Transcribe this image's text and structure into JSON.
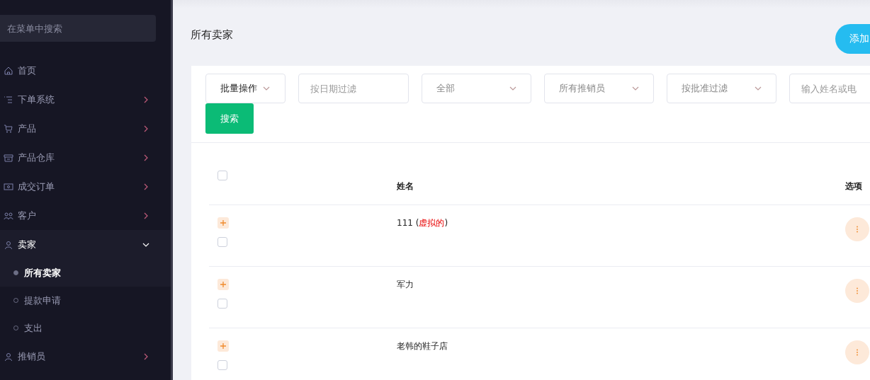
{
  "sidebar": {
    "search": {
      "placeholder": "在菜单中搜索"
    },
    "items": [
      {
        "label": "首页",
        "expandable": false,
        "expanded": false
      },
      {
        "label": "下单系统",
        "expandable": true,
        "expanded": false
      },
      {
        "label": "产品",
        "expandable": true,
        "expanded": false
      },
      {
        "label": "产品仓库",
        "expandable": true,
        "expanded": false
      },
      {
        "label": "成交订单",
        "expandable": true,
        "expanded": false
      },
      {
        "label": "客户",
        "expandable": true,
        "expanded": false
      },
      {
        "label": "卖家",
        "expandable": true,
        "expanded": true,
        "children": [
          {
            "label": "所有卖家",
            "selected": true
          },
          {
            "label": "提款申请",
            "selected": false
          },
          {
            "label": "支出",
            "selected": false
          }
        ]
      },
      {
        "label": "推销员",
        "expandable": true,
        "expanded": false
      }
    ]
  },
  "page": {
    "title": "所有卖家",
    "add_button": "添加"
  },
  "filters": [
    {
      "kind": "action",
      "text": "批量操作"
    },
    {
      "kind": "input",
      "placeholder": "按日期过滤"
    },
    {
      "kind": "select",
      "text": "全部"
    },
    {
      "kind": "select",
      "text": "所有推销员"
    },
    {
      "kind": "select",
      "text": "按批准过滤"
    },
    {
      "kind": "input",
      "placeholder": "输入姓名或电"
    }
  ],
  "search_button": "搜索",
  "table": {
    "columns": [
      "姓名",
      "选项"
    ],
    "header_checked": false,
    "rows": [
      {
        "checked": false,
        "name_parts": [
          {
            "kind": "plain",
            "text": "111 ("
          },
          {
            "kind": "virtual",
            "text": "虚拟的"
          },
          {
            "kind": "plain",
            "text": ")"
          }
        ]
      },
      {
        "checked": false,
        "name_parts": [
          {
            "kind": "plain",
            "text": "军力"
          }
        ]
      },
      {
        "checked": false,
        "name_parts": [
          {
            "kind": "plain",
            "text": "老韩的鞋子店"
          }
        ]
      }
    ]
  }
}
